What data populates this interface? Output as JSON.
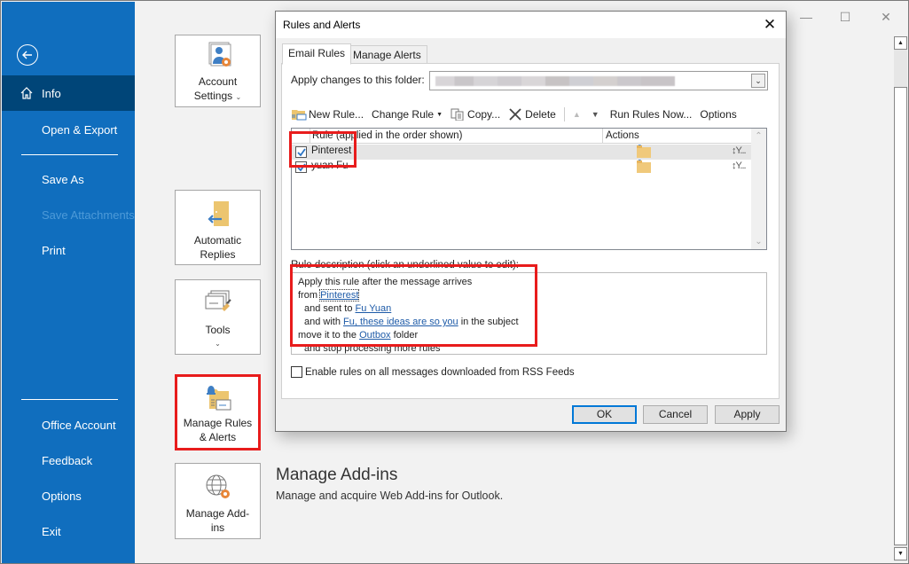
{
  "window": {
    "caption_buttons": {
      "minimize": "—",
      "maximize": "☐",
      "close": "✕"
    }
  },
  "backstage": {
    "back_label": "Back",
    "items": [
      {
        "label": "Info",
        "icon": "home-icon",
        "active": true
      },
      {
        "label": "Open & Export"
      },
      {
        "label": "Save As"
      },
      {
        "label": "Save Attachments",
        "disabled": true
      },
      {
        "label": "Print"
      },
      {
        "label": "Office Account"
      },
      {
        "label": "Feedback"
      },
      {
        "label": "Options"
      },
      {
        "label": "Exit"
      }
    ],
    "colors": {
      "background": "#106ebe",
      "active": "#004578"
    }
  },
  "tiles": {
    "account_settings": {
      "line1": "Account",
      "line2": "Settings",
      "chevron": "⌄"
    },
    "automatic_replies": {
      "line1": "Automatic",
      "line2": "Replies"
    },
    "tools": {
      "line1": "Tools",
      "chevron": "⌄"
    },
    "manage_rules": {
      "line1": "Manage Rules",
      "line2": "& Alerts"
    },
    "manage_addins": {
      "line1": "Manage Add-",
      "line2": "ins"
    }
  },
  "addins_section": {
    "title": "Manage Add-ins",
    "description": "Manage and acquire Web Add-ins for Outlook."
  },
  "dialog": {
    "title": "Rules and Alerts",
    "close": "✕",
    "tabs": [
      {
        "label": "Email Rules",
        "active": true
      },
      {
        "label": "Manage Alerts"
      }
    ],
    "folder_label": "Apply changes to this folder:",
    "folder_value": "",
    "toolbar": {
      "new_rule": "New Rule...",
      "change_rule": "Change Rule",
      "copy": "Copy...",
      "delete": "Delete",
      "move_up": "▲",
      "move_down": "▼",
      "run_rules_now": "Run Rules Now...",
      "options": "Options"
    },
    "rules_list": {
      "columns": [
        "Rule (applied in the order shown)",
        "Actions"
      ],
      "rows": [
        {
          "name": "Pinterest",
          "checked": true,
          "selected": true,
          "action": "move-to-folder",
          "tool": "↕Y..."
        },
        {
          "name": "yuan Fu",
          "checked": true,
          "selected": false,
          "action": "move-to-folder",
          "tool": "↕Y..."
        }
      ]
    },
    "description_label": "Rule description (click an underlined value to edit):",
    "description": {
      "line1": "Apply this rule after the message arrives",
      "line2_prefix": "from ",
      "line2_link": "Pinterest",
      "line3_prefix": "and sent to ",
      "line3_link": "Fu Yuan",
      "line4_prefix": "and with ",
      "line4_link": "Fu, these ideas are so you",
      "line4_suffix": " in the subject",
      "line5_prefix": "move it to the ",
      "line5_link": "Outbox",
      "line5_suffix": " folder",
      "line6": "and stop processing more rules"
    },
    "rss_checkbox": {
      "label": "Enable rules on all messages downloaded from RSS Feeds",
      "checked": false
    },
    "buttons": {
      "ok": "OK",
      "cancel": "Cancel",
      "apply": "Apply"
    }
  },
  "highlight_color": "#e81c1c"
}
